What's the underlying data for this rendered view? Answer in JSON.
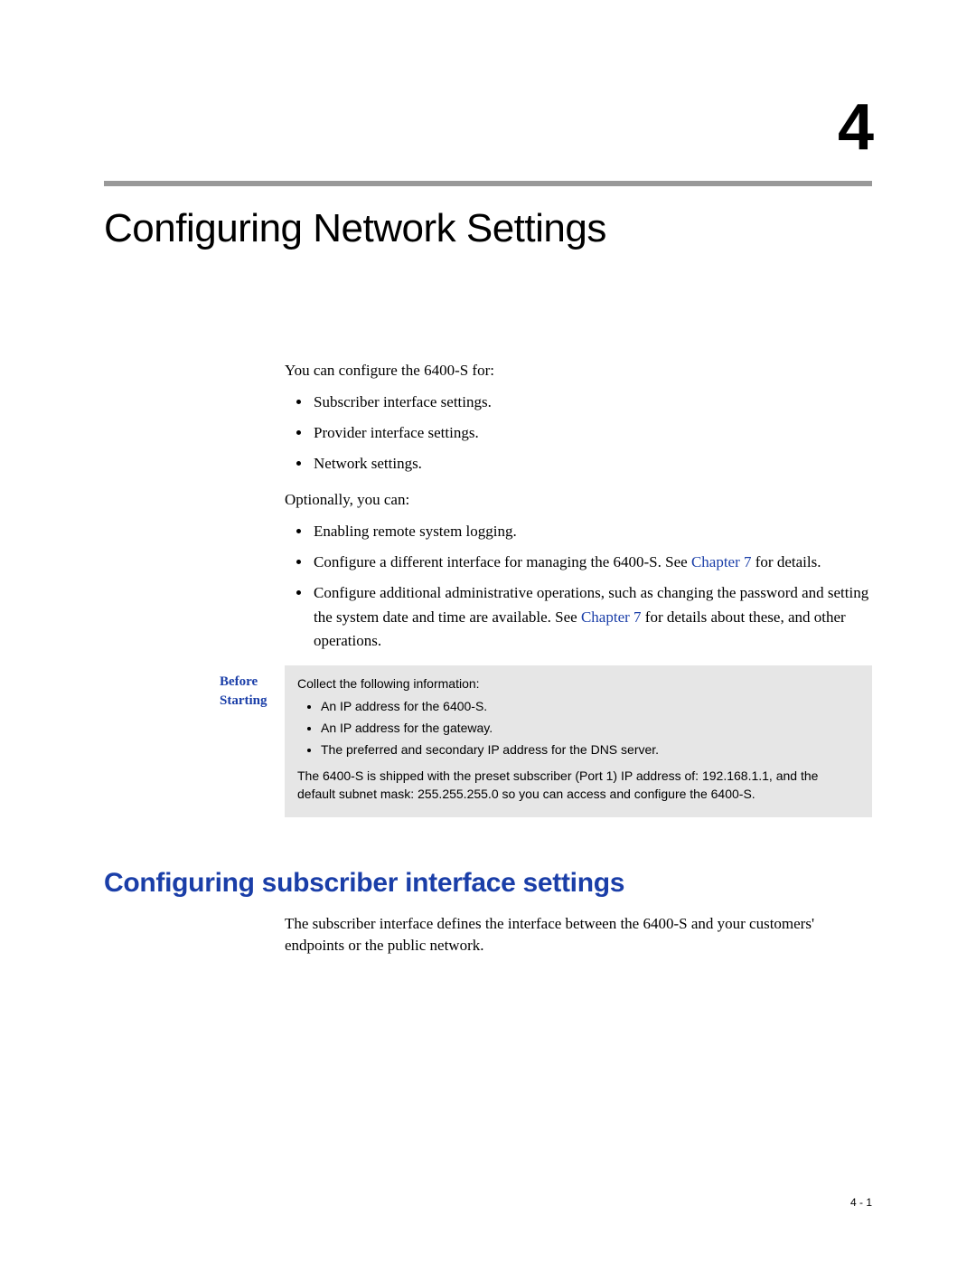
{
  "chapter": {
    "number": "4",
    "title": "Configuring Network Settings"
  },
  "intro": {
    "para1": "You can configure the 6400-S for:",
    "list1": [
      "Subscriber interface settings.",
      "Provider interface settings.",
      "Network settings."
    ],
    "para2": "Optionally, you can:",
    "list2_item0": "Enabling remote system logging.",
    "list2_item1_pre": "Configure a different interface for managing the 6400-S. See ",
    "list2_item1_link": "Chapter 7",
    "list2_item1_post": " for details.",
    "list2_item2_pre": "Configure additional administrative operations, such as changing the password and setting the system date and time are available. See ",
    "list2_item2_link": "Chapter 7",
    "list2_item2_post": " for details about these, and other operations."
  },
  "before": {
    "label": "Before Starting",
    "lead": "Collect the following information:",
    "items": [
      "An IP address for the 6400-S.",
      "An IP address for the gateway.",
      "The preferred and secondary IP address for the DNS server."
    ],
    "trailer": "The 6400-S is shipped with the preset subscriber (Port 1) IP address of: 192.168.1.1, and the default subnet mask: 255.255.255.0 so you can access and configure the 6400-S."
  },
  "section": {
    "title": "Configuring subscriber interface settings",
    "para": "The subscriber interface defines the interface between the 6400-S and your customers' endpoints or the public network."
  },
  "page_number": "4 - 1"
}
